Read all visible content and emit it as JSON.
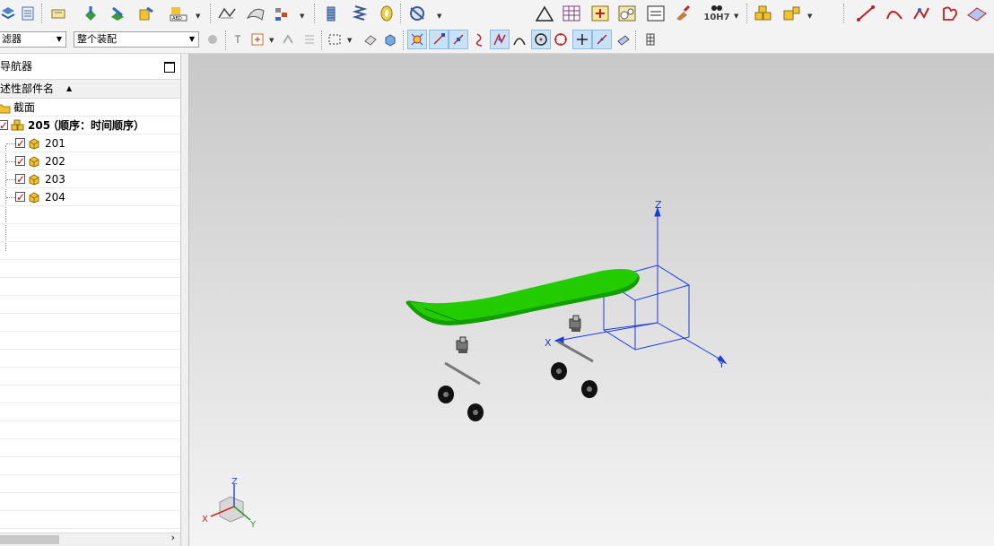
{
  "toolbar_top": {
    "icons": [
      "layers-icon",
      "notes-icon",
      "assembly-icon",
      "pick-part-icon",
      "replace-component-icon",
      "abd-text-icon",
      "curve-feature-icon",
      "surface-feature-icon",
      "explode-icon",
      "bolt-icon",
      "spring-icon",
      "bearing-icon",
      "gear-assembly-icon",
      "triangle-icon",
      "table-icon",
      "cross-section-icon",
      "camera-icon",
      "drawing-icon",
      "brush-icon",
      "fit-tolerance-icon",
      "part-blocks-icon",
      "part-blocks-2-icon",
      "line-icon",
      "arc-icon",
      "polyline-icon",
      "shape-icon",
      "render-icon"
    ],
    "fit_label": "10H7"
  },
  "toolbar_second": {
    "filter_label": "滤器",
    "scope_label": "整个装配"
  },
  "navigator": {
    "title": "导航器",
    "column_header": "述性部件名",
    "section_name": "截面",
    "root": {
      "name": "205",
      "suffix": "（顺序：时间顺序）"
    },
    "parts": [
      "201",
      "202",
      "203",
      "204"
    ]
  },
  "viewport": {
    "axes": {
      "x": "X",
      "y": "Y",
      "z": "Z"
    },
    "triad": {
      "x": "X",
      "y": "Y",
      "z": "Z"
    },
    "colors": {
      "deck": "#22cc00",
      "axis": "#1a3ce0",
      "wheel": "#111111"
    }
  }
}
